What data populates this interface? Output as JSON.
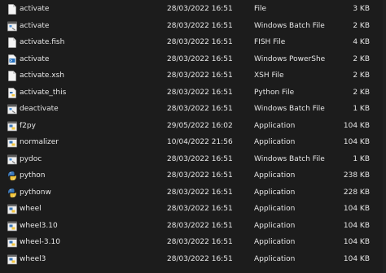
{
  "files": [
    {
      "name": "activate",
      "date": "28/03/2022 16:51",
      "type": "File",
      "size": "3 KB",
      "icon": "file-icon"
    },
    {
      "name": "activate",
      "date": "28/03/2022 16:51",
      "type": "Windows Batch File",
      "size": "2 KB",
      "icon": "batch-file-icon"
    },
    {
      "name": "activate.fish",
      "date": "28/03/2022 16:51",
      "type": "FISH File",
      "size": "4 KB",
      "icon": "file-icon"
    },
    {
      "name": "activate",
      "date": "28/03/2022 16:51",
      "type": "Windows PowerShell ...",
      "size": "2 KB",
      "icon": "powershell-file-icon"
    },
    {
      "name": "activate.xsh",
      "date": "28/03/2022 16:51",
      "type": "XSH File",
      "size": "2 KB",
      "icon": "file-icon"
    },
    {
      "name": "activate_this",
      "date": "28/03/2022 16:51",
      "type": "Python File",
      "size": "2 KB",
      "icon": "python-file-icon"
    },
    {
      "name": "deactivate",
      "date": "28/03/2022 16:51",
      "type": "Windows Batch File",
      "size": "1 KB",
      "icon": "batch-file-icon"
    },
    {
      "name": "f2py",
      "date": "29/05/2022 16:02",
      "type": "Application",
      "size": "104 KB",
      "icon": "python-app-icon"
    },
    {
      "name": "normalizer",
      "date": "10/04/2022 21:56",
      "type": "Application",
      "size": "104 KB",
      "icon": "python-app-icon"
    },
    {
      "name": "pydoc",
      "date": "28/03/2022 16:51",
      "type": "Windows Batch File",
      "size": "1 KB",
      "icon": "batch-file-icon"
    },
    {
      "name": "python",
      "date": "28/03/2022 16:51",
      "type": "Application",
      "size": "238 KB",
      "icon": "python-exe-icon"
    },
    {
      "name": "pythonw",
      "date": "28/03/2022 16:51",
      "type": "Application",
      "size": "228 KB",
      "icon": "python-exe-icon"
    },
    {
      "name": "wheel",
      "date": "28/03/2022 16:51",
      "type": "Application",
      "size": "104 KB",
      "icon": "python-app-icon"
    },
    {
      "name": "wheel3.10",
      "date": "28/03/2022 16:51",
      "type": "Application",
      "size": "104 KB",
      "icon": "python-app-icon"
    },
    {
      "name": "wheel-3.10",
      "date": "28/03/2022 16:51",
      "type": "Application",
      "size": "104 KB",
      "icon": "python-app-icon"
    },
    {
      "name": "wheel3",
      "date": "28/03/2022 16:51",
      "type": "Application",
      "size": "104 KB",
      "icon": "python-app-icon"
    }
  ],
  "colors": {
    "background": "#1c1c1c",
    "text": "#e6e6e6",
    "python_blue": "#3b77b8",
    "python_yellow": "#f2c53d"
  }
}
